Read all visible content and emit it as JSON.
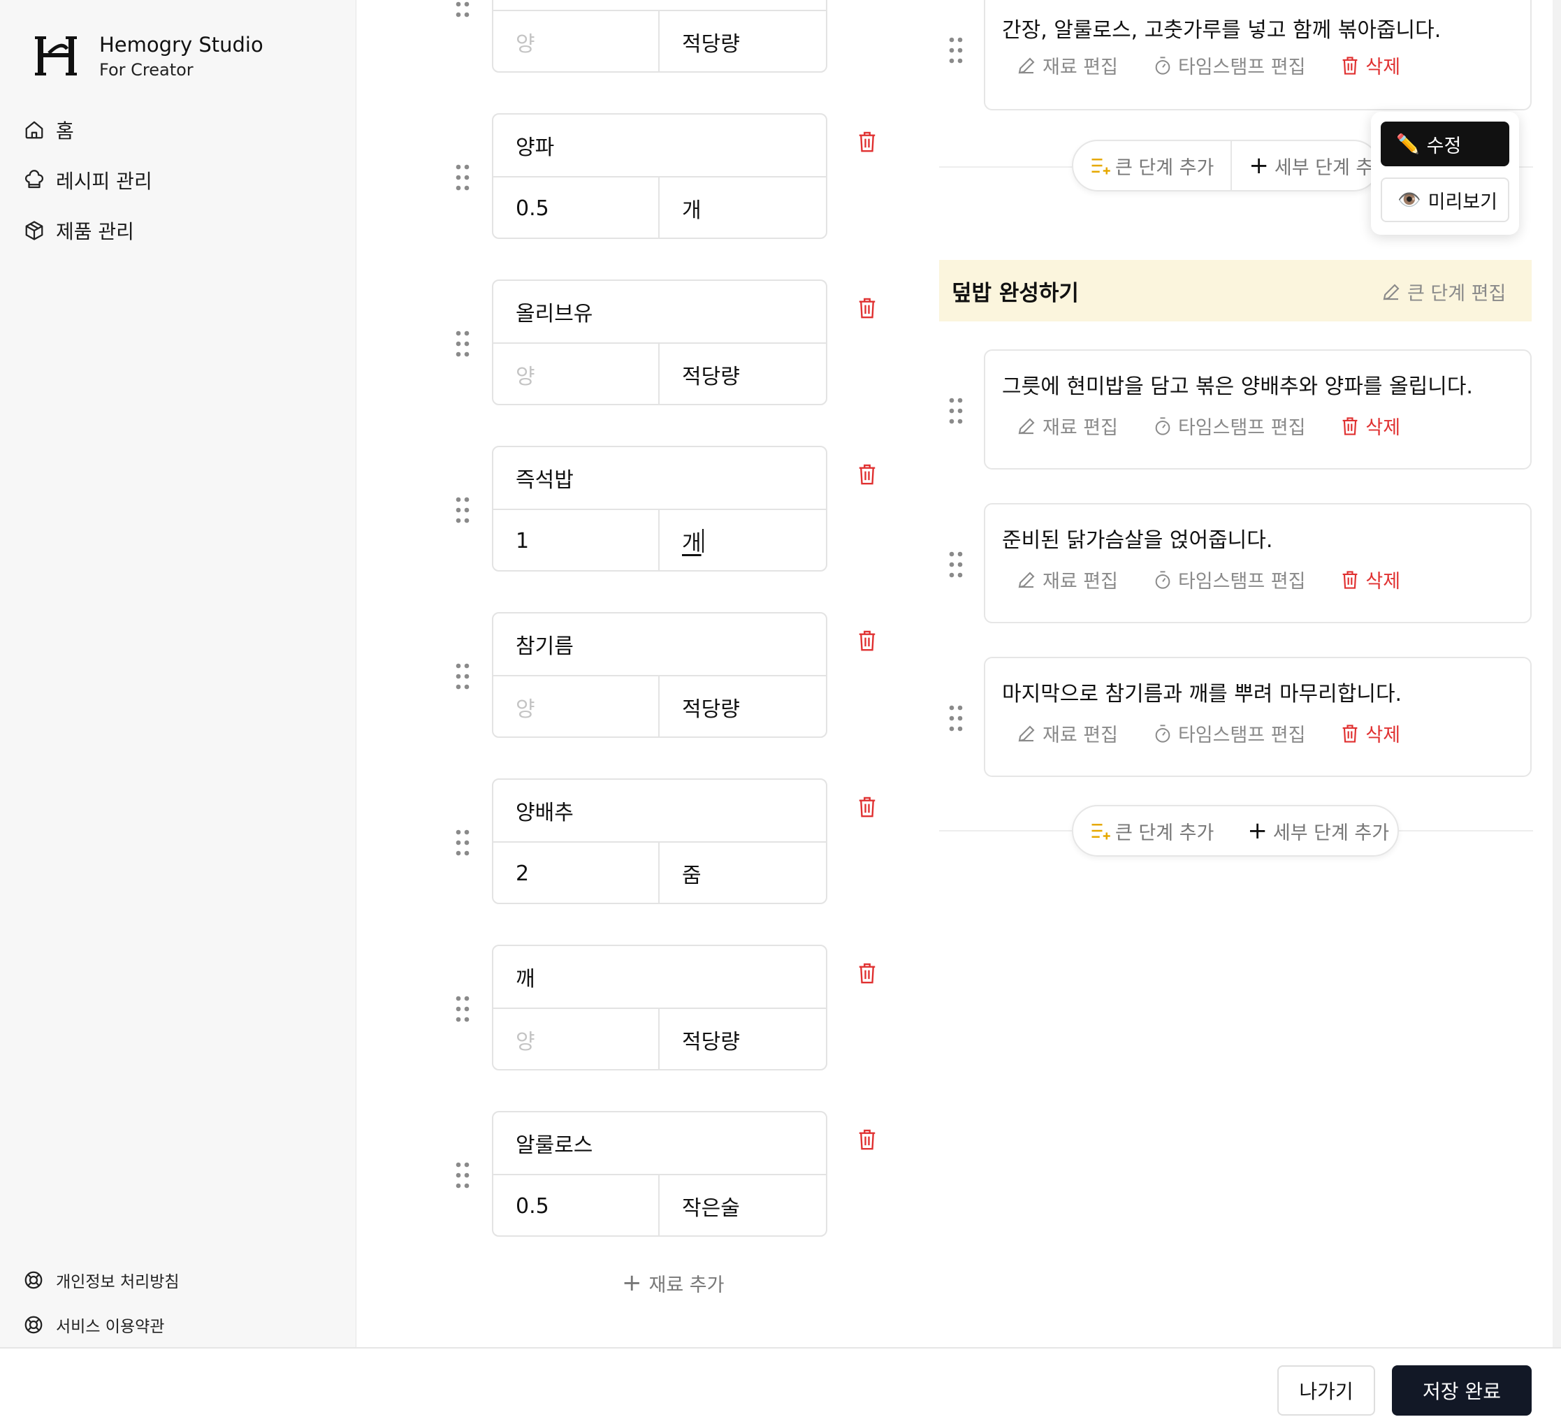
{
  "brand": {
    "name": "Hemogry Studio",
    "subtitle": "For Creator"
  },
  "sidebar": {
    "items": [
      {
        "label": "홈",
        "icon": "home-icon"
      },
      {
        "label": "레시피 관리",
        "icon": "chef-hat-icon"
      },
      {
        "label": "제품 관리",
        "icon": "package-icon"
      }
    ],
    "footer": [
      {
        "label": "개인정보 처리방침",
        "icon": "lifebuoy-icon"
      },
      {
        "label": "서비스 이용약관",
        "icon": "lifebuoy-icon"
      }
    ]
  },
  "ingredients": [
    {
      "name": "",
      "qty": "",
      "qty_placeholder": "양",
      "unit": "적당량"
    },
    {
      "name": "양파",
      "qty": "0.5",
      "qty_placeholder": "양",
      "unit": "개"
    },
    {
      "name": "올리브유",
      "qty": "",
      "qty_placeholder": "양",
      "unit": "적당량"
    },
    {
      "name": "즉석밥",
      "qty": "1",
      "qty_placeholder": "양",
      "unit": "개"
    },
    {
      "name": "참기름",
      "qty": "",
      "qty_placeholder": "양",
      "unit": "적당량"
    },
    {
      "name": "양배추",
      "qty": "2",
      "qty_placeholder": "양",
      "unit": "줌"
    },
    {
      "name": "깨",
      "qty": "",
      "qty_placeholder": "양",
      "unit": "적당량"
    },
    {
      "name": "알룰로스",
      "qty": "0.5",
      "qty_placeholder": "양",
      "unit": "작은술"
    }
  ],
  "add_ingredient_label": "재료 추가",
  "step_actions": {
    "edit_ingredients": "재료 편집",
    "edit_timestamp": "타임스탬프 편집",
    "delete": "삭제"
  },
  "steps_top": [
    {
      "text": "간장, 알룰로스, 고춧가루를 넣고 함께 볶아줍니다."
    }
  ],
  "big_step": {
    "title": "덮밥 완성하기",
    "edit_label": "큰 단계 편집"
  },
  "steps_bottom": [
    {
      "text": "그릇에 현미밥을 담고 볶은 양배추와 양파를 올립니다."
    },
    {
      "text": "준비된 닭가슴살을 얹어줍니다."
    },
    {
      "text": "마지막으로 참기름과 깨를 뿌려 마무리합니다."
    }
  ],
  "add_bar": {
    "big_step": "큰 단계 추가",
    "sub_step": "세부 단계 추가",
    "sub_step_truncated": "세부 단계 추가"
  },
  "mode_popup": {
    "edit": "수정",
    "edit_emoji": "✏️",
    "preview": "미리보기",
    "preview_emoji": "👁️"
  },
  "bottom_bar": {
    "exit": "나가기",
    "save": "저장 완료"
  },
  "colors": {
    "accent_dark": "#121826",
    "danger": "#e03131",
    "big_step_bg": "#fbf5dd",
    "add_icon": "#e6a800"
  }
}
